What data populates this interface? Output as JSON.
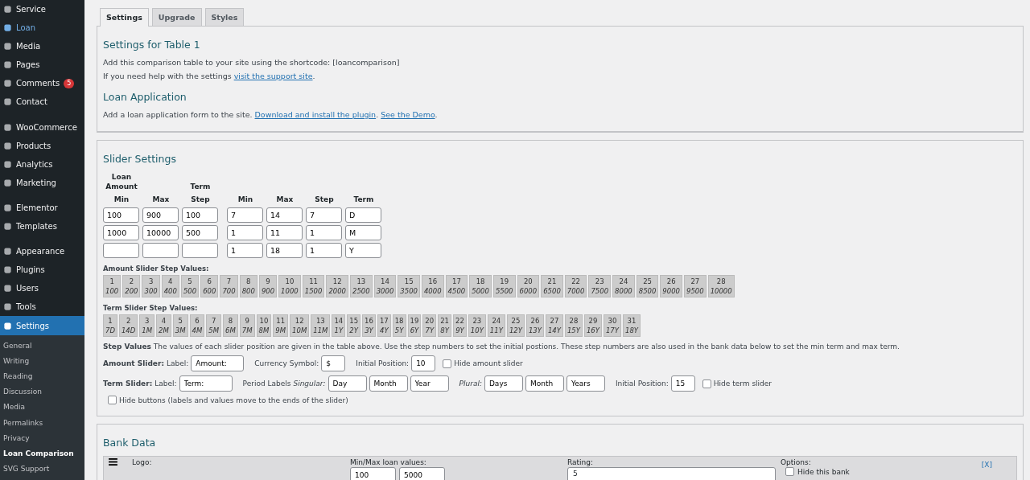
{
  "sidebar": {
    "items": [
      {
        "label": "Service",
        "selected": false,
        "highlighted": false,
        "group_end": false
      },
      {
        "label": "Loan",
        "selected": false,
        "highlighted": true,
        "group_end": false
      },
      {
        "label": "Media",
        "selected": false,
        "highlighted": false,
        "group_end": false
      },
      {
        "label": "Pages",
        "selected": false,
        "highlighted": false,
        "group_end": false
      },
      {
        "label": "Comments",
        "selected": false,
        "highlighted": false,
        "group_end": false,
        "badge": "5"
      },
      {
        "label": "Contact",
        "selected": false,
        "highlighted": false,
        "group_end": true
      },
      {
        "label": "WooCommerce",
        "selected": false,
        "highlighted": false,
        "group_end": false
      },
      {
        "label": "Products",
        "selected": false,
        "highlighted": false,
        "group_end": false
      },
      {
        "label": "Analytics",
        "selected": false,
        "highlighted": false,
        "group_end": false
      },
      {
        "label": "Marketing",
        "selected": false,
        "highlighted": false,
        "group_end": true
      },
      {
        "label": "Elementor",
        "selected": false,
        "highlighted": false,
        "group_end": false
      },
      {
        "label": "Templates",
        "selected": false,
        "highlighted": false,
        "group_end": true
      },
      {
        "label": "Appearance",
        "selected": false,
        "highlighted": false,
        "group_end": false
      },
      {
        "label": "Plugins",
        "selected": false,
        "highlighted": false,
        "group_end": false
      },
      {
        "label": "Users",
        "selected": false,
        "highlighted": false,
        "group_end": false
      },
      {
        "label": "Tools",
        "selected": false,
        "highlighted": false,
        "group_end": false
      },
      {
        "label": "Settings",
        "selected": true,
        "highlighted": false,
        "group_end": false
      }
    ],
    "submenu": [
      {
        "label": "General",
        "selected": false
      },
      {
        "label": "Writing",
        "selected": false
      },
      {
        "label": "Reading",
        "selected": false
      },
      {
        "label": "Discussion",
        "selected": false
      },
      {
        "label": "Media",
        "selected": false
      },
      {
        "label": "Permalinks",
        "selected": false
      },
      {
        "label": "Privacy",
        "selected": false
      },
      {
        "label": "Loan Comparison",
        "selected": true
      },
      {
        "label": "SVG Support",
        "selected": false
      }
    ]
  },
  "tabs": [
    {
      "label": "Settings",
      "selected": true
    },
    {
      "label": "Upgrade",
      "selected": false
    },
    {
      "label": "Styles",
      "selected": false
    }
  ],
  "intro": {
    "title": "Settings for Table 1",
    "shortcode_text": "Add this comparison table to your site using the shortcode: [loancomparison]",
    "help_text": "If you need help with the settings ",
    "help_link": "visit the support site",
    "help_tail": ".",
    "app_sep": ". ",
    "app_tail": ".",
    "app_title": "Loan Application",
    "app_text": "Add a loan application form to the site. ",
    "app_link_1": "Download and install the plugin",
    "app_link_2": "See the Demo"
  },
  "slider_settings": {
    "title": "Slider Settings",
    "loan_header": "Loan Amount",
    "term_header": "Term",
    "columns": [
      "Min",
      "Max",
      "Step",
      "Min",
      "Max",
      "Step",
      "Term"
    ],
    "rows": [
      [
        "100",
        "900",
        "100",
        "7",
        "14",
        "7",
        "D"
      ],
      [
        "1000",
        "10000",
        "500",
        "1",
        "11",
        "1",
        "M"
      ],
      [
        "",
        "",
        "",
        "1",
        "18",
        "1",
        "Y"
      ]
    ],
    "amount_steps_title": "Amount Slider Step Values:",
    "amount_steps": [
      [
        "1",
        "100"
      ],
      [
        "2",
        "200"
      ],
      [
        "3",
        "300"
      ],
      [
        "4",
        "400"
      ],
      [
        "5",
        "500"
      ],
      [
        "6",
        "600"
      ],
      [
        "7",
        "700"
      ],
      [
        "8",
        "800"
      ],
      [
        "9",
        "900"
      ],
      [
        "10",
        "1000"
      ],
      [
        "11",
        "1500"
      ],
      [
        "12",
        "2000"
      ],
      [
        "13",
        "2500"
      ],
      [
        "14",
        "3000"
      ],
      [
        "15",
        "3500"
      ],
      [
        "16",
        "4000"
      ],
      [
        "17",
        "4500"
      ],
      [
        "18",
        "5000"
      ],
      [
        "19",
        "5500"
      ],
      [
        "20",
        "6000"
      ],
      [
        "21",
        "6500"
      ],
      [
        "22",
        "7000"
      ],
      [
        "23",
        "7500"
      ],
      [
        "24",
        "8000"
      ],
      [
        "25",
        "8500"
      ],
      [
        "26",
        "9000"
      ],
      [
        "27",
        "9500"
      ],
      [
        "28",
        "10000"
      ]
    ],
    "term_steps_title": "Term Slider Step Values:",
    "term_steps": [
      [
        "1",
        "7D"
      ],
      [
        "2",
        "14D"
      ],
      [
        "3",
        "1M"
      ],
      [
        "4",
        "2M"
      ],
      [
        "5",
        "3M"
      ],
      [
        "6",
        "4M"
      ],
      [
        "7",
        "5M"
      ],
      [
        "8",
        "6M"
      ],
      [
        "9",
        "7M"
      ],
      [
        "10",
        "8M"
      ],
      [
        "11",
        "9M"
      ],
      [
        "12",
        "10M"
      ],
      [
        "13",
        "11M"
      ],
      [
        "14",
        "1Y"
      ],
      [
        "15",
        "2Y"
      ],
      [
        "16",
        "3Y"
      ],
      [
        "17",
        "4Y"
      ],
      [
        "18",
        "5Y"
      ],
      [
        "19",
        "6Y"
      ],
      [
        "20",
        "7Y"
      ],
      [
        "21",
        "8Y"
      ],
      [
        "22",
        "9Y"
      ],
      [
        "23",
        "10Y"
      ],
      [
        "24",
        "11Y"
      ],
      [
        "25",
        "12Y"
      ],
      [
        "26",
        "13Y"
      ],
      [
        "27",
        "14Y"
      ],
      [
        "28",
        "15Y"
      ],
      [
        "29",
        "16Y"
      ],
      [
        "30",
        "17Y"
      ],
      [
        "31",
        "18Y"
      ]
    ],
    "step_note": "**Step Values** The values of each slider position are given in the table above. Use the step numbers to set the initial postions. These step numbers are also used in the bank data below to set the min term and max term.",
    "amount_slider": {
      "title": "Amount Slider:",
      "label_caption": "Label:",
      "label_value": "Amount:",
      "currency_caption": "Currency Symbol:",
      "currency_value": "$",
      "position_caption": "Initial Position:",
      "position_value": "10",
      "hide_label": "Hide amount slider",
      "hide_checked": false
    },
    "term_slider": {
      "title": "Term Slider:",
      "label_caption": "Label:",
      "label_value": "Term:",
      "period_caption": "Period Labels",
      "singular_caption": "Singular:",
      "singular": [
        "Day",
        "Month",
        "Year"
      ],
      "plural_caption": "Plural:",
      "plural": [
        "Days",
        "Month",
        "Years"
      ],
      "position_caption": "Initial Position:",
      "position_value": "15",
      "hide_label": "Hide term slider",
      "hide_checked": false
    },
    "hide_buttons": {
      "label": "Hide buttons (labels and values move to the ends of the slider)",
      "checked": false
    }
  },
  "bank_data": {
    "title": "Bank Data",
    "logo_caption": "Logo:",
    "minmax_caption": "Min/Max loan values:",
    "min_value": "100",
    "max_value": "5000",
    "rating_caption": "Rating:",
    "rating_value": "5",
    "options_caption": "Options:",
    "hide_bank_label": "Hide this bank",
    "hide_bank_checked": false,
    "remove_link": "[X]"
  }
}
